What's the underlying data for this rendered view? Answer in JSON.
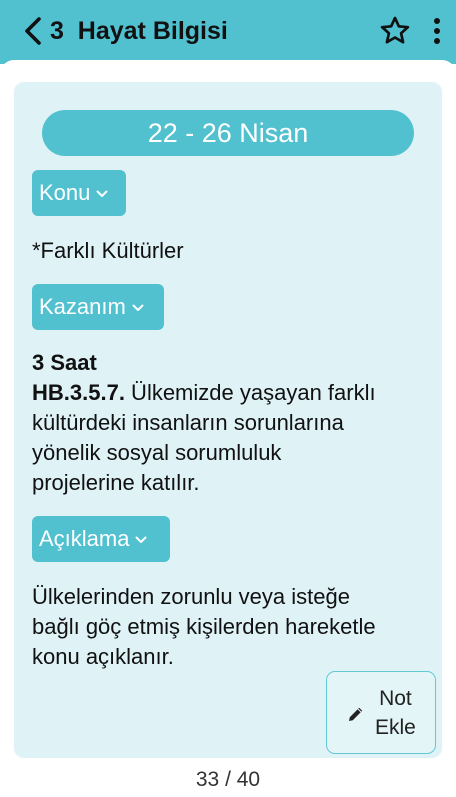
{
  "header": {
    "back_icon": "chevron-left-icon",
    "title": "3  Hayat Bilgisi",
    "star_icon": "star-outline-icon",
    "more_icon": "more-vertical-icon",
    "accent_color": "#51c1d0"
  },
  "card": {
    "date_range": "22 - 26 Nisan",
    "topic": {
      "label": "Konu",
      "text": "*Farklı Kültürler"
    },
    "outcome": {
      "label": "Kazanım",
      "hours": "3 Saat",
      "code": "HB.3.5.7.",
      "line1_rest": " Ülkemizde yaşayan farklı",
      "line2": "kültürdeki insanların sorunlarına",
      "line3": "yönelik sosyal sorumluluk",
      "line4": "projelerine katılır."
    },
    "explanation": {
      "label": "Açıklama",
      "line1": "Ülkelerinden zorunlu veya isteğe",
      "line2": "bağlı göç etmiş kişilerden hareketle",
      "line3": "konu açıklanır."
    },
    "note_button": {
      "line1": "Not",
      "line2": "Ekle",
      "icon": "pencil-icon"
    }
  },
  "pager": {
    "text": "33 / 40"
  }
}
